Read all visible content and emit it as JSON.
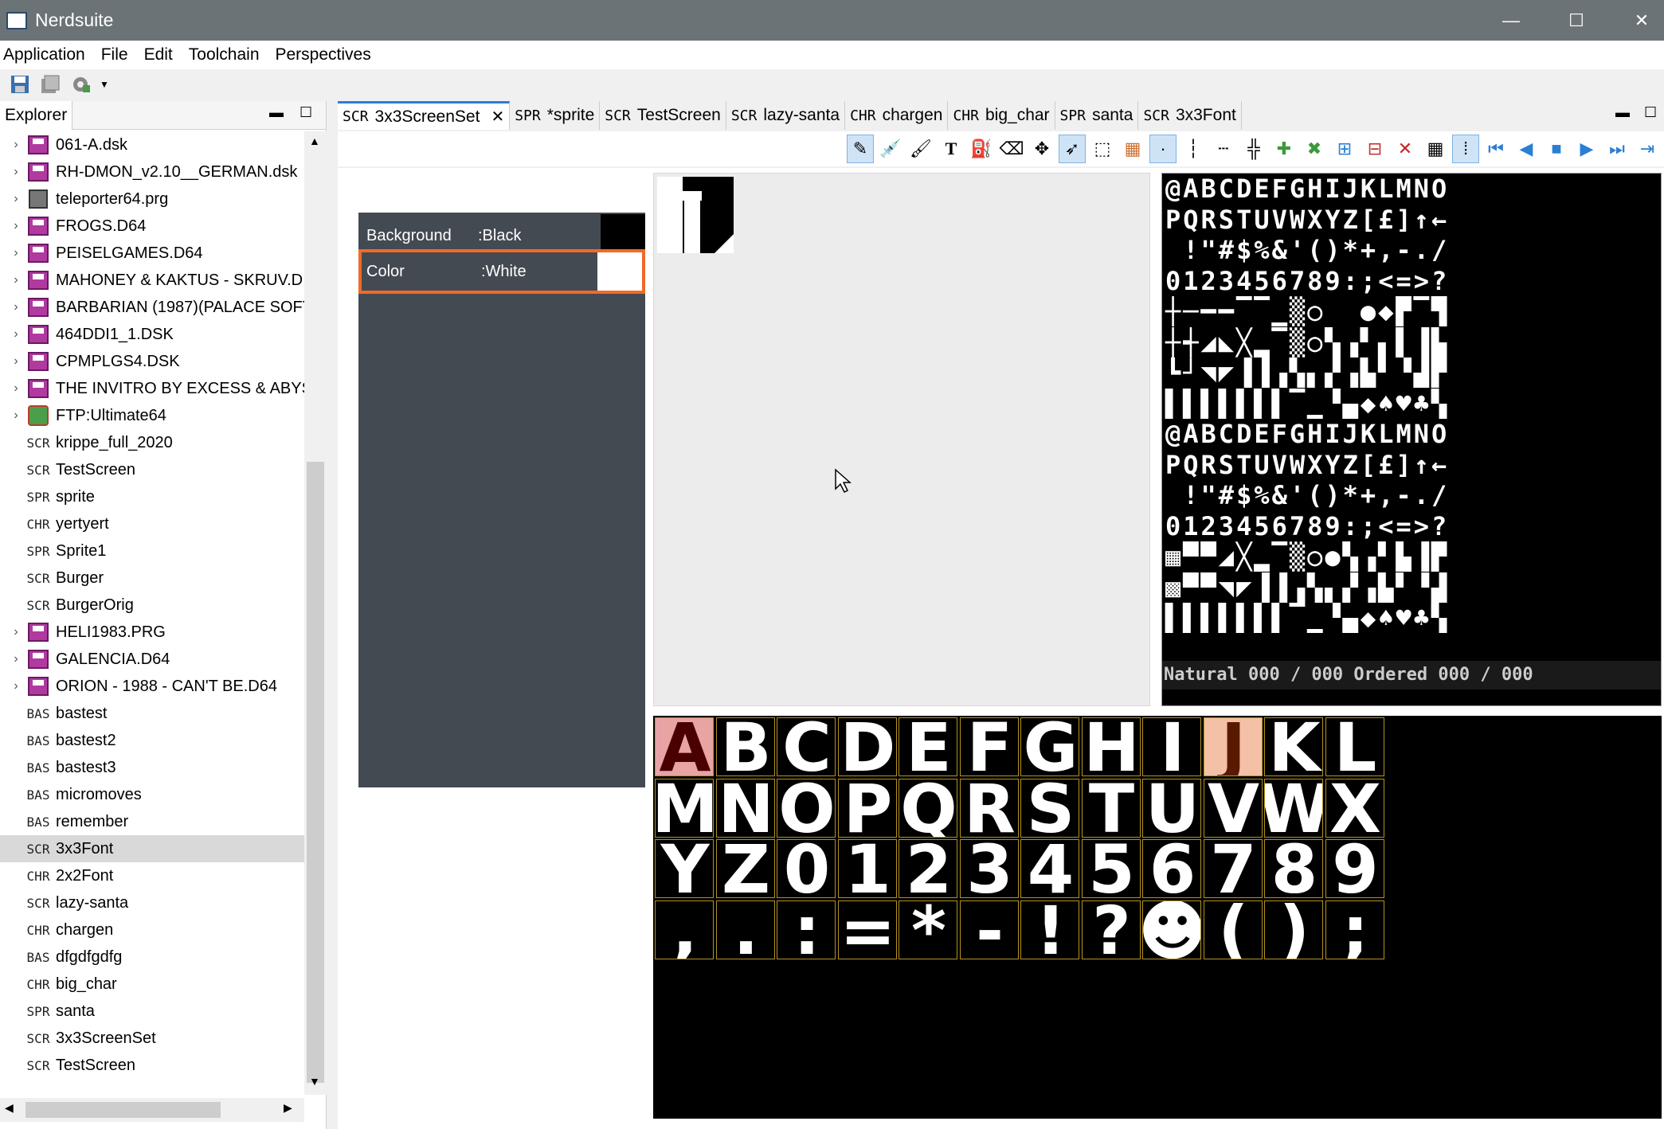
{
  "window": {
    "title": "Nerdsuite",
    "minimize": "—",
    "maximize": "☐",
    "close": "✕"
  },
  "menu": [
    "Application",
    "File",
    "Edit",
    "Toolchain",
    "Perspectives"
  ],
  "explorer": {
    "tab_label": "Explorer",
    "items": [
      {
        "type": "disk",
        "prefix": "",
        "label": "061-A.dsk",
        "expandable": true
      },
      {
        "type": "disk",
        "prefix": "",
        "label": "RH-DMON_v2.10__GERMAN.dsk",
        "expandable": true
      },
      {
        "type": "prg",
        "prefix": "",
        "label": "teleporter64.prg",
        "expandable": true
      },
      {
        "type": "disk",
        "prefix": "",
        "label": "FROGS.D64",
        "expandable": true
      },
      {
        "type": "disk",
        "prefix": "",
        "label": "PEISELGAMES.D64",
        "expandable": true
      },
      {
        "type": "disk",
        "prefix": "",
        "label": "MAHONEY & KAKTUS - SKRUV.D",
        "expandable": true
      },
      {
        "type": "disk",
        "prefix": "",
        "label": "BARBARIAN (1987)(PALACE SOFT",
        "expandable": true
      },
      {
        "type": "disk",
        "prefix": "",
        "label": "464DDI1_1.DSK",
        "expandable": true
      },
      {
        "type": "disk",
        "prefix": "",
        "label": "CPMPLGS4.DSK",
        "expandable": true
      },
      {
        "type": "disk",
        "prefix": "",
        "label": "THE INVITRO BY EXCESS & ABYS",
        "expandable": true
      },
      {
        "type": "ftp",
        "prefix": "",
        "label": "FTP:Ultimate64",
        "expandable": true
      },
      {
        "type": "text",
        "prefix": "SCR",
        "label": "krippe_full_2020",
        "expandable": false
      },
      {
        "type": "text",
        "prefix": "SCR",
        "label": "TestScreen",
        "expandable": false
      },
      {
        "type": "text",
        "prefix": "SPR",
        "label": "sprite",
        "expandable": false
      },
      {
        "type": "text",
        "prefix": "CHR",
        "label": "yertyert",
        "expandable": false
      },
      {
        "type": "text",
        "prefix": "SPR",
        "label": "Sprite1",
        "expandable": false
      },
      {
        "type": "text",
        "prefix": "SCR",
        "label": "Burger",
        "expandable": false
      },
      {
        "type": "text",
        "prefix": "SCR",
        "label": "BurgerOrig",
        "expandable": false
      },
      {
        "type": "disk",
        "prefix": "",
        "label": "HELI1983.PRG",
        "expandable": true
      },
      {
        "type": "disk",
        "prefix": "",
        "label": "GALENCIA.D64",
        "expandable": true
      },
      {
        "type": "disk",
        "prefix": "",
        "label": "ORION - 1988 - CAN'T BE.D64",
        "expandable": true
      },
      {
        "type": "text",
        "prefix": "BAS",
        "label": "bastest",
        "expandable": false
      },
      {
        "type": "text",
        "prefix": "BAS",
        "label": "bastest2",
        "expandable": false
      },
      {
        "type": "text",
        "prefix": "BAS",
        "label": "bastest3",
        "expandable": false
      },
      {
        "type": "text",
        "prefix": "BAS",
        "label": "micromoves",
        "expandable": false
      },
      {
        "type": "text",
        "prefix": "BAS",
        "label": "remember",
        "expandable": false
      },
      {
        "type": "text",
        "prefix": "SCR",
        "label": "3x3Font",
        "expandable": false,
        "selected": true
      },
      {
        "type": "text",
        "prefix": "CHR",
        "label": "2x2Font",
        "expandable": false
      },
      {
        "type": "text",
        "prefix": "SCR",
        "label": "lazy-santa",
        "expandable": false
      },
      {
        "type": "text",
        "prefix": "CHR",
        "label": "chargen",
        "expandable": false
      },
      {
        "type": "text",
        "prefix": "BAS",
        "label": "dfgdfgdfg",
        "expandable": false
      },
      {
        "type": "text",
        "prefix": "CHR",
        "label": "big_char",
        "expandable": false
      },
      {
        "type": "text",
        "prefix": "SPR",
        "label": "santa",
        "expandable": false
      },
      {
        "type": "text",
        "prefix": "SCR",
        "label": "3x3ScreenSet",
        "expandable": false
      },
      {
        "type": "text",
        "prefix": "SCR",
        "label": "TestScreen",
        "expandable": false
      }
    ]
  },
  "editor_tabs": [
    {
      "prefix": "SCR",
      "label": "3x3ScreenSet",
      "active": true,
      "closable": true
    },
    {
      "prefix": "SPR",
      "label": "*sprite"
    },
    {
      "prefix": "SCR",
      "label": "TestScreen"
    },
    {
      "prefix": "SCR",
      "label": "lazy-santa"
    },
    {
      "prefix": "CHR",
      "label": "chargen"
    },
    {
      "prefix": "CHR",
      "label": "big_char"
    },
    {
      "prefix": "SPR",
      "label": "santa"
    },
    {
      "prefix": "SCR",
      "label": "3x3Font"
    }
  ],
  "colors": {
    "background_label": "Background",
    "background_value": ":Black",
    "background_swatch": "#000000",
    "color_label": "Color",
    "color_value": ":White",
    "color_swatch": "#ffffff",
    "highlight": "#f06a28",
    "panel_bg": "#444a52"
  },
  "charset": {
    "rows": [
      "@ABCDEFGHIJKLMNO",
      "PQRSTUVWXYZ[£]↑←",
      " !\"#$%&'()*+,-./",
      "0123456789:;<=>?",
      "┼─━━▔▔▁▒○  ●◆▛▔▜",
      "┼┽◢◣╳▂▔▒○▚▗▘▖▌▐▙",
      "┗┘◥◤▐▐▗▚▖▞▗▙▘▝▟▛",
      "▌▌▌▌▌▌▌▔▁▝▄◆♠♥♣▚",
      "@ABCDEFGHIJKLMNO",
      "PQRSTUVWXYZ[£]↑←",
      " !\"#$%&'()*+,-./",
      "0123456789:;<=>?",
      "▦▀▀◢╳▂▔▒○●▚▗▘▙▐▛",
      "▩▀▀◥◤▐▐▗▚▖▞▗▙▘▝▟",
      "▌▌▌▌▌▌▌▔▁▝▄◆♠♥♣▚"
    ],
    "status": "Natural 000 / 000 Ordered 000 / 000"
  },
  "screen_chars": [
    [
      "A",
      "B",
      "C",
      "D",
      "E",
      "F",
      "G",
      "H",
      "I",
      "J",
      "K",
      "L"
    ],
    [
      "M",
      "N",
      "O",
      "P",
      "Q",
      "R",
      "S",
      "T",
      "U",
      "V",
      "W",
      "X"
    ],
    [
      "Y",
      "Z",
      "0",
      "1",
      "2",
      "3",
      "4",
      "5",
      "6",
      "7",
      "8",
      "9"
    ],
    [
      ",",
      ".",
      ":",
      "=",
      "*",
      "-",
      "!",
      "?",
      "☻",
      "(",
      ")",
      ";"
    ]
  ],
  "preview_char": "A"
}
